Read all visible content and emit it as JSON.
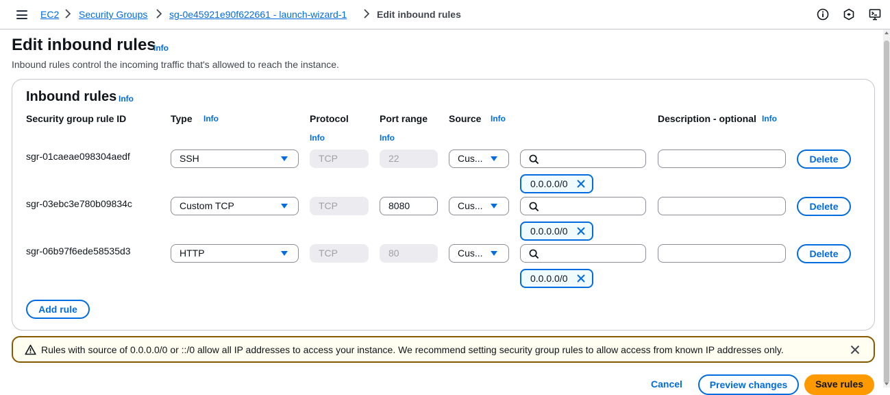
{
  "breadcrumb": {
    "items": [
      "EC2",
      "Security Groups",
      "sg-0e45921e90f622661 - launch-wizard-1"
    ],
    "current": "Edit inbound rules"
  },
  "header": {
    "title": "Edit inbound rules",
    "info": "Info",
    "description": "Inbound rules control the incoming traffic that's allowed to reach the instance."
  },
  "container": {
    "title": "Inbound rules",
    "info": "Info",
    "columns": {
      "rule_id": "Security group rule ID",
      "type": "Type",
      "protocol": "Protocol",
      "port_range": "Port range",
      "source": "Source",
      "description": "Description - optional"
    }
  },
  "rules": [
    {
      "id": "sgr-01caeae098304aedf",
      "type": "SSH",
      "protocol": "TCP",
      "port": "22",
      "port_editable": false,
      "source": "Cus...",
      "cidr": "0.0.0.0/0"
    },
    {
      "id": "sgr-03ebc3e780b09834c",
      "type": "Custom TCP",
      "protocol": "TCP",
      "port": "8080",
      "port_editable": true,
      "source": "Cus...",
      "cidr": "0.0.0.0/0"
    },
    {
      "id": "sgr-06b97f6ede58535d3",
      "type": "HTTP",
      "protocol": "TCP",
      "port": "80",
      "port_editable": false,
      "source": "Cus...",
      "cidr": "0.0.0.0/0"
    }
  ],
  "actions": {
    "delete": "Delete",
    "add_rule": "Add rule",
    "cancel": "Cancel",
    "preview": "Preview changes",
    "save": "Save rules"
  },
  "warning": {
    "text": "Rules with source of 0.0.0.0/0 or ::/0 allow all IP addresses to access your instance. We recommend setting security group rules to allow access from known IP addresses only."
  },
  "icons": [
    "menu-icon",
    "info-circle-icon",
    "hexagon-icon",
    "cloudshell-icon",
    "search-icon",
    "close-icon",
    "warning-icon"
  ],
  "colors": {
    "link": "#006ce0",
    "primary": "#ff9900",
    "warning_border": "#855900"
  }
}
